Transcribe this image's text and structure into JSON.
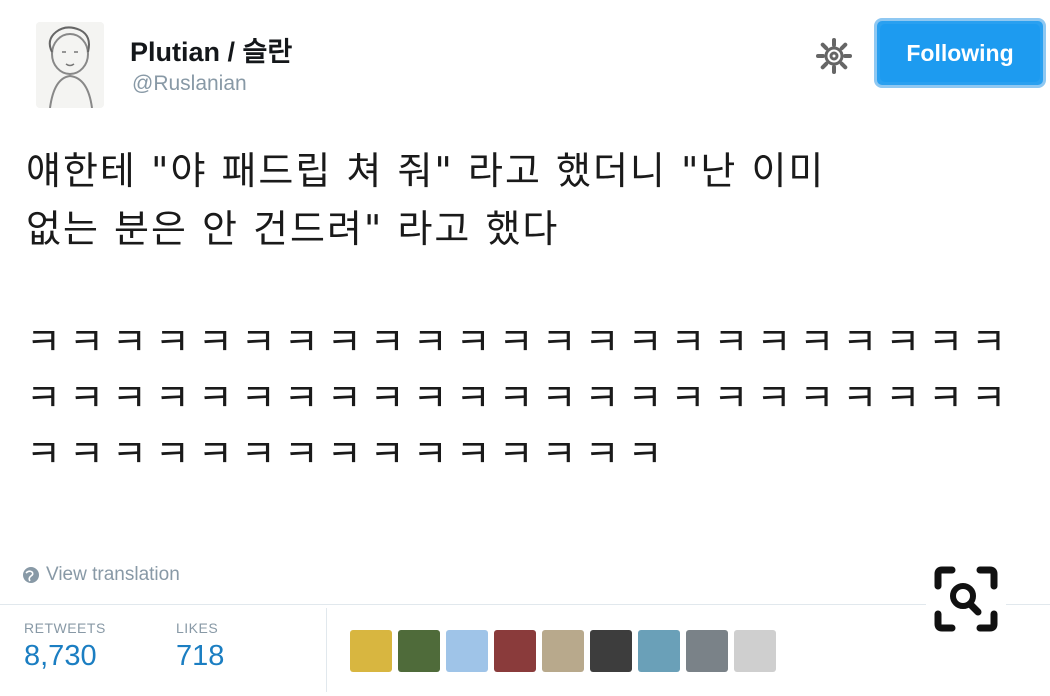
{
  "user": {
    "display_name": "Plutian / 슬란",
    "screen_name": "@Ruslanian"
  },
  "header": {
    "follow_label": "Following",
    "gear_icon": "gear-icon"
  },
  "tweet": {
    "line1": "얘한테 \"야 패드립 쳐 줘\" 라고 했더니 \"난 이미",
    "line2": "없는 분은 안 건드려\" 라고 했다",
    "laugh": "ㅋㅋㅋㅋㅋㅋㅋㅋㅋㅋㅋㅋㅋㅋㅋㅋㅋㅋㅋㅋㅋㅋㅋㅋㅋㅋㅋㅋㅋㅋㅋㅋㅋㅋㅋㅋㅋㅋㅋㅋㅋㅋㅋㅋㅋㅋㅋㅋㅋㅋㅋㅋㅋㅋㅋㅋㅋㅋㅋㅋㅋ",
    "translate_label": "View translation"
  },
  "stats": {
    "retweets_label": "RETWEETS",
    "retweets_value": "8,730",
    "likes_label": "LIKES",
    "likes_value": "718"
  },
  "likers": [
    {
      "name": "liker-avatar-1",
      "color": "#d8b640"
    },
    {
      "name": "liker-avatar-2",
      "color": "#4f6b3a"
    },
    {
      "name": "liker-avatar-3",
      "color": "#9fc4e8"
    },
    {
      "name": "liker-avatar-4",
      "color": "#8a3b3b"
    },
    {
      "name": "liker-avatar-5",
      "color": "#b8a98c"
    },
    {
      "name": "liker-avatar-6",
      "color": "#3d3d3d"
    },
    {
      "name": "liker-avatar-7",
      "color": "#6aa0b8"
    },
    {
      "name": "liker-avatar-8",
      "color": "#7a8288"
    },
    {
      "name": "liker-avatar-9",
      "color": "#cfcfcf"
    }
  ],
  "colors": {
    "accent": "#1d9bf0",
    "stat_value": "#1b7ec2",
    "muted": "#8899a6"
  }
}
